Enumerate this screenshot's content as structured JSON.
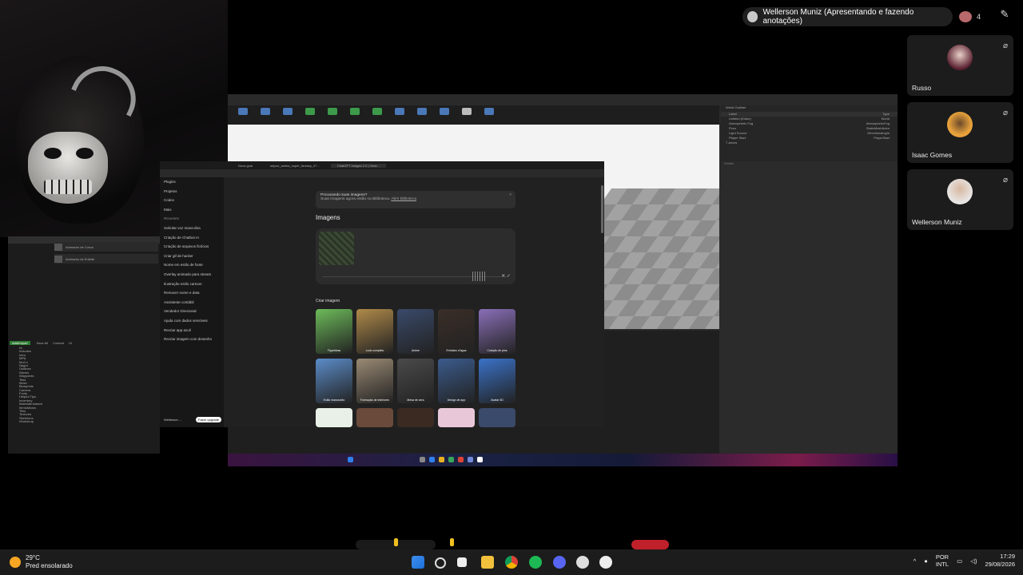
{
  "meeting": {
    "presenter_label": "Wellerson Muniz (Apresentando e fazendo anotações)",
    "participant_count": "4",
    "participants": [
      {
        "name": "Russo",
        "muted": true
      },
      {
        "name": "Isaac Gomes",
        "muted": true
      },
      {
        "name": "Wellerson Muniz",
        "muted": true
      }
    ]
  },
  "shared_screen": {
    "ue": {
      "content_browser": {
        "add_import": "Add/Import",
        "save_all": "Save All",
        "path_content": "Content",
        "path_ui": "UI",
        "tree": [
          "IA",
          "Includes",
          "Intro",
          "MPA",
          "MoCo",
          "Nagut",
          "Outlines",
          "Waves",
          "Waypoints",
          "Tiles",
          "Mesh",
          "Blueprints",
          "Camera",
          "Fonts",
          "Helpful Tips",
          "Inventory",
          "MaterialInstance",
          "ItemsMixins",
          "Tiles",
          "Textures",
          "Skeletons",
          "Workshop"
        ],
        "items": [
          "Animador de Coroa",
          "Animador de Enfeite"
        ]
      },
      "outliner": {
        "title": "World Outliner",
        "col_label": "Label",
        "col_type": "Type",
        "rows": [
          {
            "label": "Untitled (Editor)",
            "type": "World"
          },
          {
            "label": "Atmospheric Fog",
            "type": "AtmosphericFog"
          },
          {
            "label": "Floor",
            "type": "StaticMeshActor"
          },
          {
            "label": "Light Source",
            "type": "DirectionalLight"
          },
          {
            "label": "Player Start",
            "type": "PlayerStart"
          }
        ],
        "actors": "7 actors"
      },
      "details_title": "Details"
    },
    "chat_window": {
      "tabs": [
        "Nova guia",
        "sejusx_anima_super_fantasy_07...",
        "ChatGPT Images 2.0 | Gera..."
      ],
      "sidebar": {
        "items": [
          "Plugins",
          "Projetos",
          "Codex",
          "Mais"
        ],
        "recent_caption": "Recentes",
        "recent": [
          "Solicitar voz masculina",
          "Criação de Chatbot IA",
          "Criação de arquivos fictícios",
          "Criar gif de hacker",
          "Nome em estilo de fonte",
          "Overlay animado para stream",
          "Ilustração estilo cartoon",
          "Remover nome e data",
          "Assistente contábil",
          "Vendedor Direcional",
          "Ajuda com dados sensíveis",
          "Recriar app azuli",
          "Recriar imagem com desenho"
        ],
        "user": "Wellerson ...",
        "upgrade": "Fazer upgrade"
      },
      "notice_title": "Procurando suas imagens?",
      "notice_body": "Suas imagens agora estão na Biblioteca.",
      "notice_link": "Abrir biblioteca",
      "images_heading": "Imagens",
      "create_heading": "Criar imagem",
      "tiles": [
        {
          "label": "Figurinhas",
          "color": "#6dbb5a"
        },
        {
          "label": "Look completo",
          "color": "#b08a4a"
        },
        {
          "label": "Anime",
          "color": "#3a4a6a"
        },
        {
          "label": "Embaixo d'água",
          "color": "#3a2e28"
        },
        {
          "label": "Coleção de pins",
          "color": "#8a6fb8"
        },
        {
          "label": "Estilo manuscrito",
          "color": "#5b8cc8"
        },
        {
          "label": "Formação de interiores",
          "color": "#9a8a74"
        },
        {
          "label": "Mesa de cera",
          "color": "#4a4a4a"
        },
        {
          "label": "Design de app",
          "color": "#3b5b8c"
        },
        {
          "label": "Avatar 3D",
          "color": "#3a72c8"
        }
      ]
    }
  },
  "taskbar": {
    "temperature": "29°C",
    "weather_desc": "Pred ensolarado",
    "lang_top": "POR",
    "lang_bottom": "INTL",
    "time": "17:29",
    "date": "29/08/2026"
  }
}
